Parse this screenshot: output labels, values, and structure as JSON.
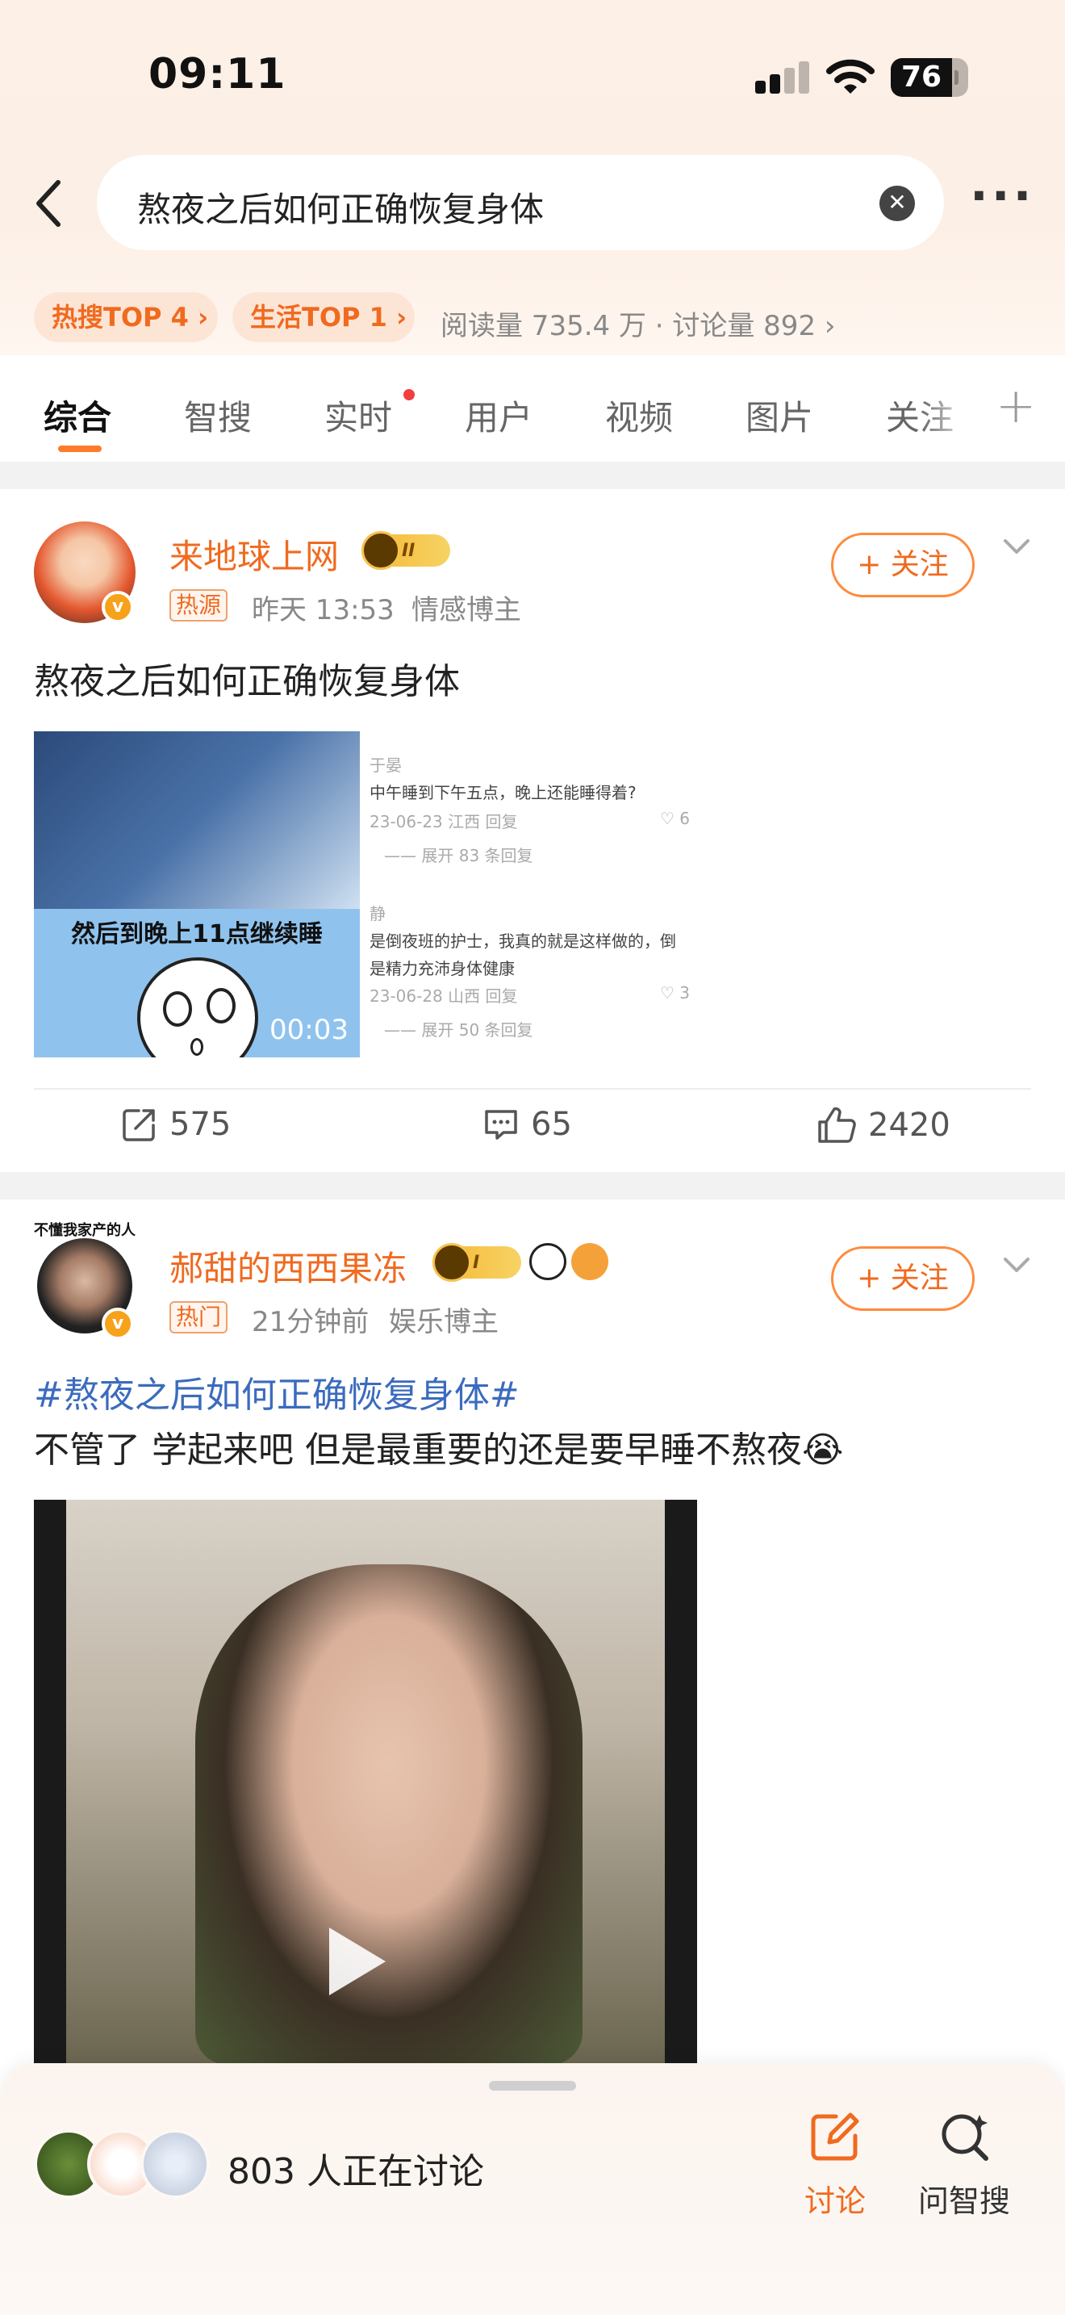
{
  "status_bar": {
    "time": "09:11",
    "battery": "76"
  },
  "search": {
    "query": "熬夜之后如何正确恢复身体"
  },
  "hot_chips": {
    "hot": "热搜TOP 4 ›",
    "life": "生活TOP 1 ›",
    "stats": "阅读量 735.4 万 · 讨论量 892 ›"
  },
  "tabs": [
    {
      "label": "综合"
    },
    {
      "label": "智搜"
    },
    {
      "label": "实时"
    },
    {
      "label": "用户"
    },
    {
      "label": "视频"
    },
    {
      "label": "图片"
    },
    {
      "label": "关注"
    }
  ],
  "post1": {
    "username": "来地球上网",
    "vip_level": "II",
    "source_tag": "热源",
    "time": "昨天 13:53",
    "category": "情感博主",
    "follow_label": "+ 关注",
    "text": "熬夜之后如何正确恢复身体",
    "video_caption": "然后到晚上11点继续睡",
    "duration": "00:03",
    "comments_image": {
      "line1": "于晏",
      "line2": "中午睡到下午五点，晚上还能睡得着?",
      "line3": "23-06-23 江西   回复",
      "like1": "♡ 6",
      "line4": "—— 展开 83 条回复",
      "line5": "静",
      "line6": "是倒夜班的护士，我真的就是这样做的，倒",
      "line7": "是精力充沛身体健康",
      "line8": "23-06-28 山西   回复",
      "like2": "♡ 3",
      "line9": "—— 展开 50 条回复"
    },
    "shares": "575",
    "comments": "65",
    "likes": "2420"
  },
  "post2": {
    "username": "郝甜的西西果冻",
    "vip_level": "I",
    "source_tag": "热门",
    "time": "21分钟前",
    "category": "娱乐博主",
    "follow_label": "+ 关注",
    "avatar_caption": "不懂我家产的人",
    "hashtag": "#熬夜之后如何正确恢复身体#",
    "text": "不管了 学起来吧 但是最重要的还是要早睡不熬夜",
    "emoji": "😭"
  },
  "bottom_sheet": {
    "discussing": "803 人正在讨论",
    "discuss_label": "讨论",
    "ask_label": "问智搜"
  },
  "colors": {
    "accent": "#f06a1f",
    "link": "#3b6bbd"
  }
}
